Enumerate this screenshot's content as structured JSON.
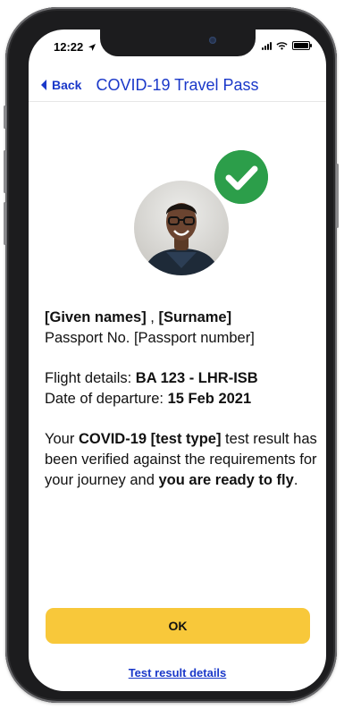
{
  "status": {
    "time": "12:22"
  },
  "nav": {
    "back_label": "Back",
    "title": "COVID-19 Travel Pass"
  },
  "traveller": {
    "given_names": "[Given names]",
    "name_separator": " , ",
    "surname": "[Surname]",
    "passport_prefix": "Passport No. ",
    "passport_number": "[Passport number]"
  },
  "flight": {
    "details_prefix": "Flight details: ",
    "details_value": "BA 123 - LHR-ISB",
    "departure_prefix": "Date of departure: ",
    "departure_value": "15 Feb 2021"
  },
  "result": {
    "part1": "Your ",
    "test_bold": "COVID-19 [test type]",
    "part2": " test result has been verified against the requirements for your journey and ",
    "ready_bold": "you are ready to fly",
    "part3": "."
  },
  "actions": {
    "ok_label": "OK",
    "details_link": "Test result details"
  },
  "colors": {
    "accent_blue": "#1a38c9",
    "button_yellow": "#f8c83a",
    "verified_green": "#2c9e4a"
  },
  "icons": {
    "verified": "check-circle-icon",
    "back": "chevron-left-icon",
    "location": "location-arrow-icon"
  }
}
